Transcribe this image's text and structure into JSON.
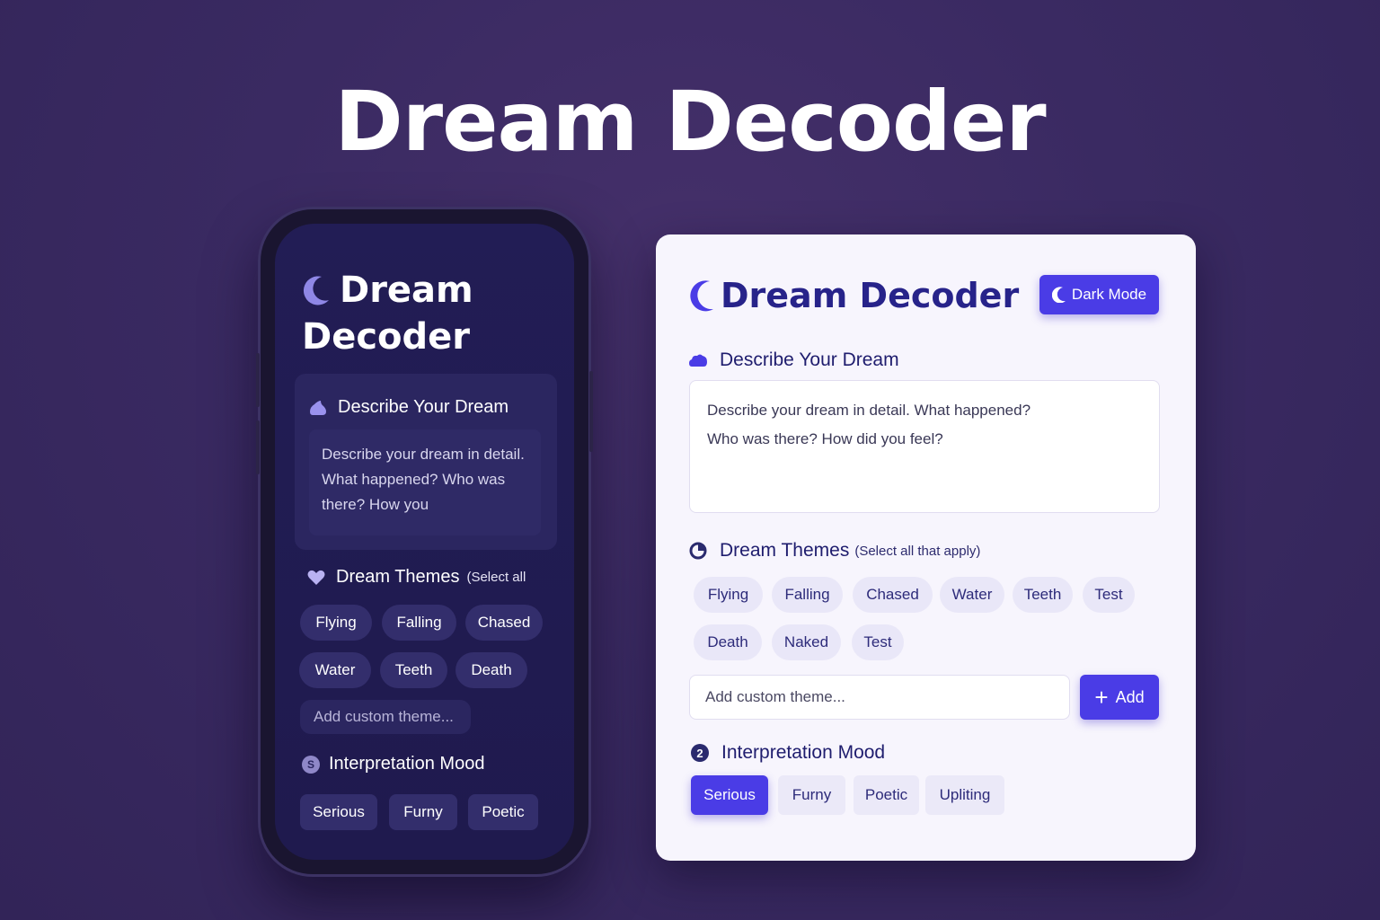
{
  "hero": {
    "title": "Dream Decoder"
  },
  "mobile": {
    "title_line1": "Dream",
    "title_line2": "Decoder",
    "describe": {
      "heading": "Describe Your Dream",
      "placeholder": "Describe your dream in detail. What happened? Who was there? How you"
    },
    "themes": {
      "heading": "Dream Themes",
      "subheading": "(Select all",
      "chips": [
        "Flying",
        "Falling",
        "Chased",
        "Water",
        "Teeth",
        "Death"
      ],
      "custom_placeholder": "Add custom theme..."
    },
    "mood": {
      "heading": "Interpretation Mood",
      "badge": "S",
      "options": [
        "Serious",
        "Furny",
        "Poetic"
      ]
    }
  },
  "desktop": {
    "title": "Dream Decoder",
    "dark_mode_label": "Dark Mode",
    "describe": {
      "heading": "Describe Your Dream",
      "placeholder_line1": "Describe your dream in detail. What happened?",
      "placeholder_line2": "Who was there? How did you feel?"
    },
    "themes": {
      "heading": "Dream Themes",
      "subheading": "(Select all that apply)",
      "chips": [
        "Flying",
        "Falling",
        "Chased",
        "Water",
        "Teeth",
        "Test",
        "Death",
        "Naked",
        "Test"
      ],
      "custom_placeholder": "Add custom theme...",
      "add_label": "Add"
    },
    "mood": {
      "heading": "Interpretation Mood",
      "badge": "2",
      "options": [
        "Serious",
        "Furny",
        "Poetic",
        "Upliting"
      ],
      "selected": "Serious"
    }
  },
  "colors": {
    "background": "#3a2a62",
    "accent": "#4a3ce6",
    "mobile_screen": "#211c52",
    "card": "#f7f5fd",
    "heading_dark": "#27238a"
  },
  "icons": [
    "moon-icon",
    "cloud-icon",
    "heart-icon",
    "pie-chart-icon",
    "plus-icon"
  ]
}
